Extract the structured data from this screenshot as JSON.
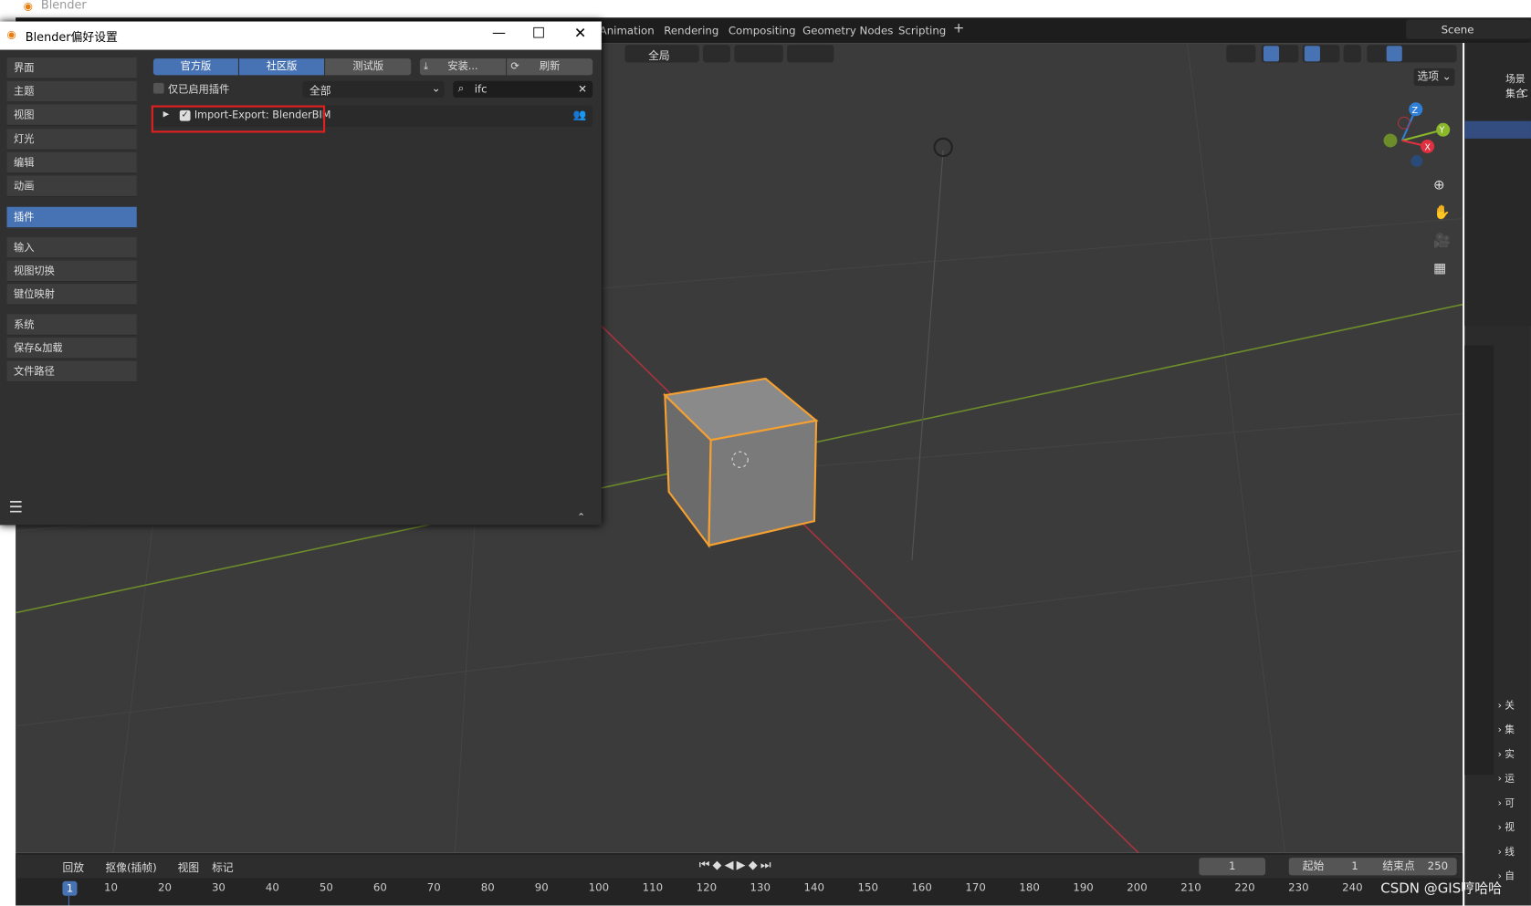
{
  "app": {
    "title": "Blender"
  },
  "topbar": {
    "workspaces": [
      "Animation",
      "Rendering",
      "Compositing",
      "Geometry Nodes",
      "Scripting"
    ],
    "add": "+",
    "scene": "Scene"
  },
  "viewport": {
    "orientation": "全局",
    "options": "选项",
    "axes": {
      "x": "X",
      "y": "Y",
      "z": "Z"
    }
  },
  "outliner": {
    "collection": "场景集合",
    "item": "C"
  },
  "prefs": {
    "title": "Blender偏好设置",
    "sidebar": [
      {
        "label": "界面"
      },
      {
        "label": "主题"
      },
      {
        "label": "视图"
      },
      {
        "label": "灯光"
      },
      {
        "label": "编辑"
      },
      {
        "label": "动画"
      },
      {
        "label": "插件",
        "active": true
      },
      {
        "label": "输入"
      },
      {
        "label": "视图切换"
      },
      {
        "label": "键位映射"
      },
      {
        "label": "系统"
      },
      {
        "label": "保存&加载"
      },
      {
        "label": "文件路径"
      }
    ],
    "tabs": [
      {
        "label": "官方版",
        "active": true
      },
      {
        "label": "社区版",
        "active": true
      },
      {
        "label": "测试版",
        "active": false
      }
    ],
    "install": "安装...",
    "refresh": "刷新",
    "enabled_only": "仅已启用插件",
    "enabled_only_checked": false,
    "category": "全部",
    "search_value": "ifc",
    "addon": {
      "name": "Import-Export: BlenderBIM",
      "enabled": true
    },
    "highlight_color": "#e02020"
  },
  "timeline": {
    "playback": "回放",
    "keying": "抠像(插帧)",
    "view": "视图",
    "marker": "标记",
    "current_frame": "1",
    "start_label": "起始",
    "start": "1",
    "end_label": "结束点",
    "end": "250",
    "ticks": [
      "1",
      "10",
      "20",
      "30",
      "40",
      "50",
      "60",
      "70",
      "80",
      "90",
      "100",
      "110",
      "120",
      "130",
      "140",
      "150",
      "160",
      "170",
      "180",
      "190",
      "200",
      "210",
      "220",
      "230",
      "240"
    ]
  },
  "properties": {
    "sections": [
      "关",
      "集",
      "实",
      "运",
      "可",
      "视",
      "线",
      "自"
    ]
  },
  "watermark": "CSDN @GIS哼哈哈"
}
